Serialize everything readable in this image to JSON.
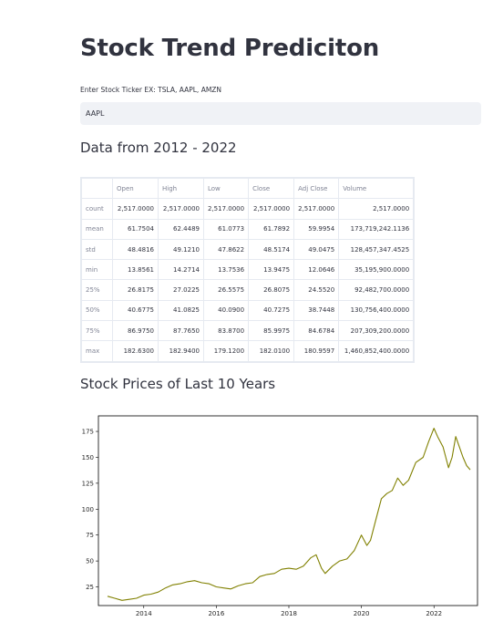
{
  "page": {
    "title": "Stock Trend Prediciton"
  },
  "ticker": {
    "label": "Enter Stock Ticker EX: TSLA, AAPL, AMZN",
    "value": "AAPL"
  },
  "sections": {
    "data_heading": "Data from 2012 - 2022",
    "chart_heading": "Stock Prices of Last 10 Years"
  },
  "table": {
    "columns": [
      "",
      "Open",
      "High",
      "Low",
      "Close",
      "Adj Close",
      "Volume"
    ],
    "rows": [
      {
        "label": "count",
        "values": [
          "2,517.0000",
          "2,517.0000",
          "2,517.0000",
          "2,517.0000",
          "2,517.0000",
          "2,517.0000"
        ]
      },
      {
        "label": "mean",
        "values": [
          "61.7504",
          "62.4489",
          "61.0773",
          "61.7892",
          "59.9954",
          "173,719,242.1136"
        ]
      },
      {
        "label": "std",
        "values": [
          "48.4816",
          "49.1210",
          "47.8622",
          "48.5174",
          "49.0475",
          "128,457,347.4525"
        ]
      },
      {
        "label": "min",
        "values": [
          "13.8561",
          "14.2714",
          "13.7536",
          "13.9475",
          "12.0646",
          "35,195,900.0000"
        ]
      },
      {
        "label": "25%",
        "values": [
          "26.8175",
          "27.0225",
          "26.5575",
          "26.8075",
          "24.5520",
          "92,482,700.0000"
        ]
      },
      {
        "label": "50%",
        "values": [
          "40.6775",
          "41.0825",
          "40.0900",
          "40.7275",
          "38.7448",
          "130,756,400.0000"
        ]
      },
      {
        "label": "75%",
        "values": [
          "86.9750",
          "87.7650",
          "83.8700",
          "85.9975",
          "84.6784",
          "207,309,200.0000"
        ]
      },
      {
        "label": "max",
        "values": [
          "182.6300",
          "182.9400",
          "179.1200",
          "182.0100",
          "180.9597",
          "1,460,852,400.0000"
        ]
      }
    ]
  },
  "chart_data": {
    "type": "line",
    "title": "",
    "xlabel": "",
    "ylabel": "",
    "x_ticks": [
      "2014",
      "2016",
      "2018",
      "2020",
      "2022"
    ],
    "y_ticks": [
      25,
      50,
      75,
      100,
      125,
      150,
      175
    ],
    "xlim": [
      2012.75,
      2023.2
    ],
    "ylim": [
      7,
      190
    ],
    "grid": false,
    "series": [
      {
        "color": "#808000",
        "x": [
          2013.0,
          2013.2,
          2013.4,
          2013.6,
          2013.8,
          2014.0,
          2014.2,
          2014.4,
          2014.6,
          2014.8,
          2015.0,
          2015.2,
          2015.4,
          2015.6,
          2015.8,
          2016.0,
          2016.2,
          2016.4,
          2016.6,
          2016.8,
          2017.0,
          2017.2,
          2017.4,
          2017.6,
          2017.8,
          2018.0,
          2018.2,
          2018.4,
          2018.6,
          2018.75,
          2018.9,
          2019.0,
          2019.2,
          2019.4,
          2019.6,
          2019.8,
          2020.0,
          2020.15,
          2020.25,
          2020.4,
          2020.55,
          2020.7,
          2020.85,
          2021.0,
          2021.15,
          2021.3,
          2021.5,
          2021.7,
          2021.85,
          2022.0,
          2022.1,
          2022.25,
          2022.4,
          2022.5,
          2022.6,
          2022.7,
          2022.8,
          2022.9,
          2023.0
        ],
        "y": [
          16,
          14,
          12,
          13,
          14,
          17,
          18,
          20,
          24,
          27,
          28,
          30,
          31,
          29,
          28,
          25,
          24,
          23,
          26,
          28,
          29,
          35,
          37,
          38,
          42,
          43,
          42,
          45,
          53,
          56,
          43,
          38,
          45,
          50,
          52,
          60,
          75,
          65,
          70,
          90,
          110,
          115,
          118,
          130,
          123,
          128,
          145,
          150,
          165,
          178,
          170,
          160,
          140,
          150,
          170,
          160,
          150,
          142,
          138
        ]
      }
    ]
  }
}
